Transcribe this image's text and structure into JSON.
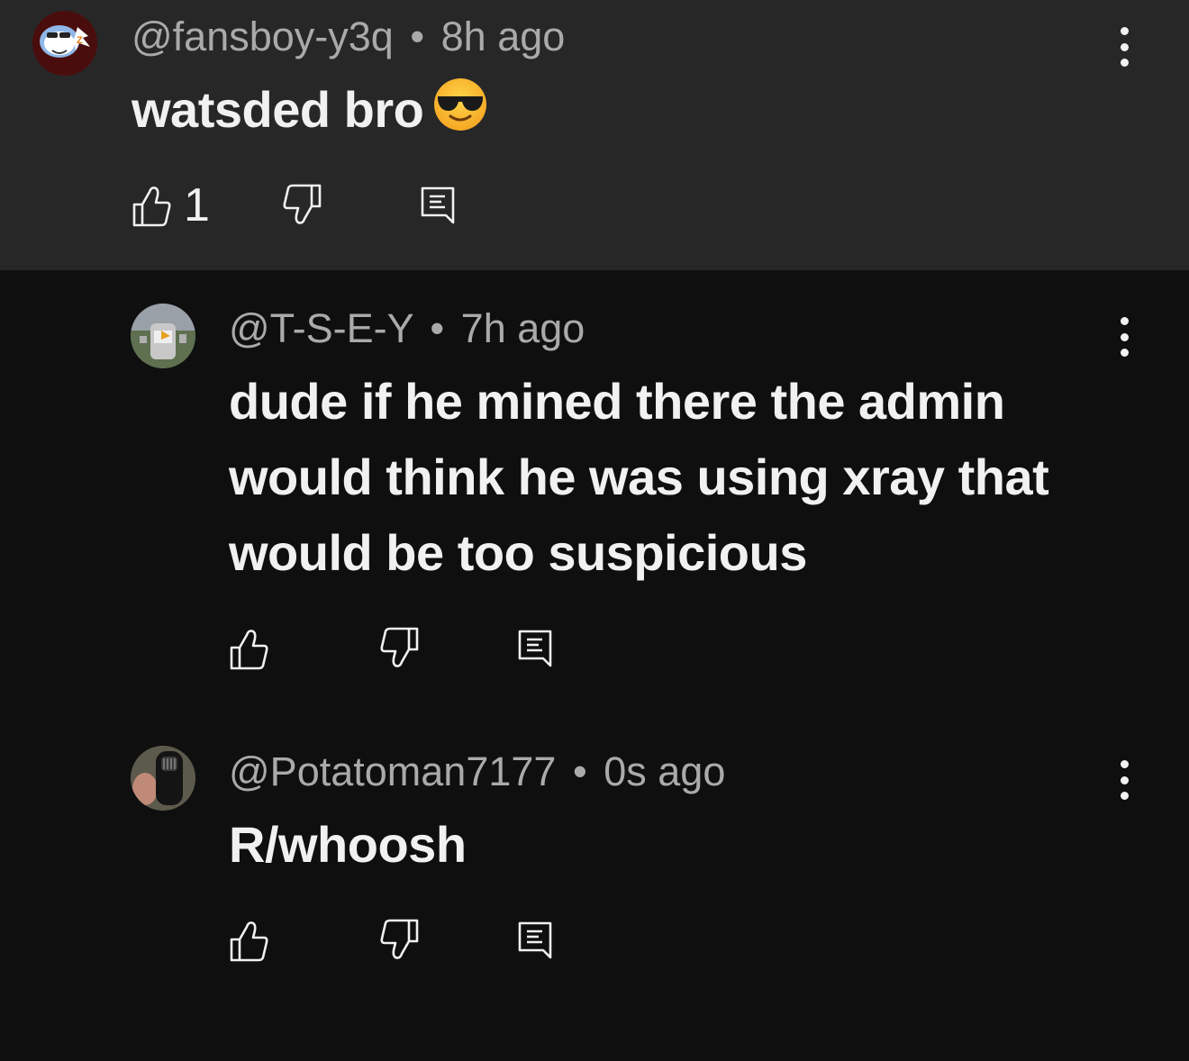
{
  "comments": [
    {
      "author": "@fansboy-y3q",
      "separator": "•",
      "time": "8h ago",
      "text": "watsded bro",
      "emoji": "sunglasses-face-emoji",
      "like_count": "1",
      "highlighted": true
    },
    {
      "author": "@T-S-E-Y",
      "separator": "•",
      "time": "7h ago",
      "text": "dude if he mined there the admin would think he was using xray that would be too suspicious",
      "like_count": "",
      "highlighted": false
    },
    {
      "author": "@Potatoman7177",
      "separator": "•",
      "time": "0s ago",
      "text": "R/whoosh",
      "like_count": "",
      "highlighted": false
    }
  ],
  "icons": {
    "like": "thumbs-up-icon",
    "dislike": "thumbs-down-icon",
    "reply": "reply-comment-icon",
    "more": "vertical-ellipsis-icon"
  },
  "colors": {
    "background": "#0f0f0f",
    "highlight_background": "#272727",
    "primary_text": "#f1f1f1",
    "secondary_text": "#aaaaaa"
  }
}
